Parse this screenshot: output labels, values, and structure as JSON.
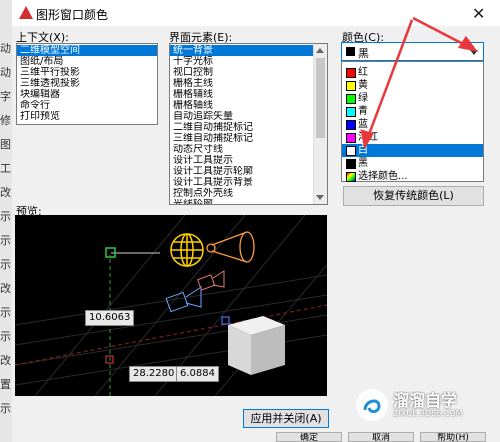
{
  "window": {
    "title": "图形窗口颜色",
    "close_glyph": "✕"
  },
  "context": {
    "label": "上下文(X):",
    "items": [
      "二维模型空间",
      "图纸/布局",
      "三维平行投影",
      "三维透视投影",
      "块编辑器",
      "命令行",
      "打印预览"
    ],
    "selected_index": 0
  },
  "interface": {
    "label": "界面元素(E):",
    "items": [
      "统一背景",
      "十字光标",
      "视口控制",
      "栅格主线",
      "栅格辅线",
      "栅格轴线",
      "自动追踪矢量",
      "二维自动捕捉标记",
      "三维自动捕捉标记",
      "动态尺寸线",
      "设计工具提示",
      "设计工具提示轮廓",
      "设计工具提示背景",
      "控制点外壳线",
      "光线轮廓"
    ],
    "selected_index": 0
  },
  "color": {
    "label": "颜色(C):",
    "selected": {
      "name": "黑",
      "hex": "#000000"
    },
    "options": [
      {
        "name": "红",
        "hex": "#ff0000"
      },
      {
        "name": "黄",
        "hex": "#ffff00"
      },
      {
        "name": "绿",
        "hex": "#00ff00"
      },
      {
        "name": "青",
        "hex": "#00ffff"
      },
      {
        "name": "蓝",
        "hex": "#0000ff"
      },
      {
        "name": "洋红",
        "hex": "#ff00ff"
      },
      {
        "name": "白",
        "hex": "#ffffff"
      },
      {
        "name": "黑",
        "hex": "#000000"
      },
      {
        "name": "选择颜色...",
        "hex": "multi"
      }
    ],
    "highlighted_index": 6
  },
  "restore_button": "恢复传统颜色(L)",
  "preview": {
    "label": "预览:",
    "readout_1": "10.6063",
    "readout_2": "28.2280",
    "readout_3": "6.0884"
  },
  "apply_close_button": "应用并关闭(A)",
  "bottom_bar": {
    "ok": "确定",
    "cancel": "取消",
    "help": "帮助(H)"
  },
  "underlying_app": {
    "left_text": [
      "动",
      "动",
      "字",
      "修",
      "图",
      "工",
      "改",
      "示",
      "示",
      "示",
      "改",
      "示",
      "示",
      "改",
      "置",
      "示"
    ]
  },
  "watermark": {
    "brand": "溜溜自学",
    "url": "ZIXUE.3D66.COM"
  },
  "accent_color": "#0078d7",
  "annotation_color": "#e8383d"
}
